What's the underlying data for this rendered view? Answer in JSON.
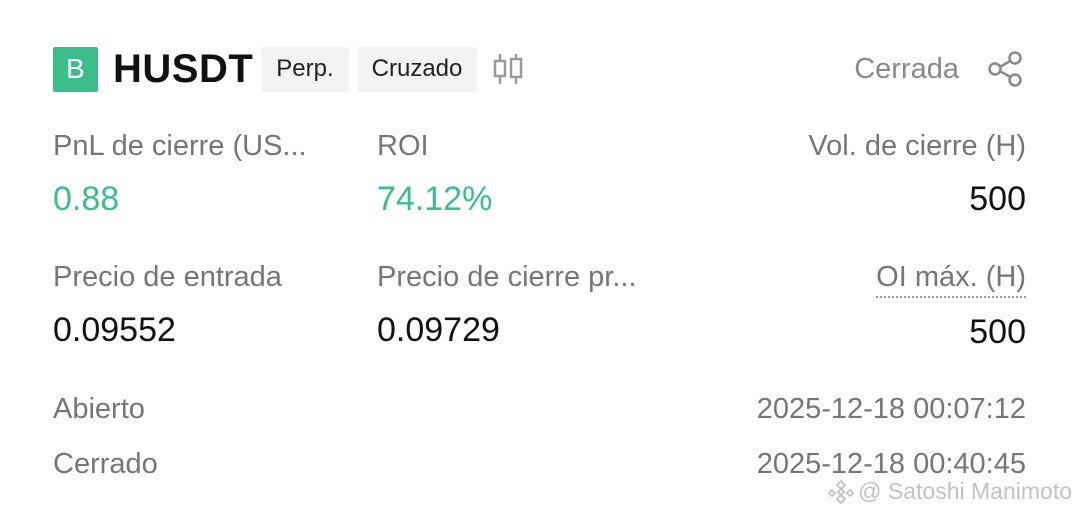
{
  "header": {
    "side_badge": "B",
    "symbol": "HUSDT",
    "contract_type": "Perp.",
    "margin_mode": "Cruzado",
    "chart_icon": "candlestick-icon",
    "status": "Cerrada",
    "share_icon": "share-icon"
  },
  "stats": {
    "closing_pnl_label": "PnL de cierre (US...",
    "closing_pnl_value": "0.88",
    "roi_label": "ROI",
    "roi_value": "74.12%",
    "closing_volume_label": "Vol. de cierre (H)",
    "closing_volume_value": "500",
    "entry_price_label": "Precio de entrada",
    "entry_price_value": "0.09552",
    "avg_close_price_label": "Precio de cierre pr...",
    "avg_close_price_value": "0.09729",
    "max_oi_label": "OI máx. (H)",
    "max_oi_value": "500"
  },
  "times": {
    "opened_label": "Abierto",
    "opened_value": "2025-12-18 00:07:12",
    "closed_label": "Cerrado",
    "closed_value": "2025-12-18 00:40:45"
  },
  "watermark": {
    "text": "@ Satoshi Manimoto",
    "icon": "binance-logo-icon"
  },
  "colors": {
    "accent_green": "#3bbd8c",
    "muted_text": "#767676"
  }
}
